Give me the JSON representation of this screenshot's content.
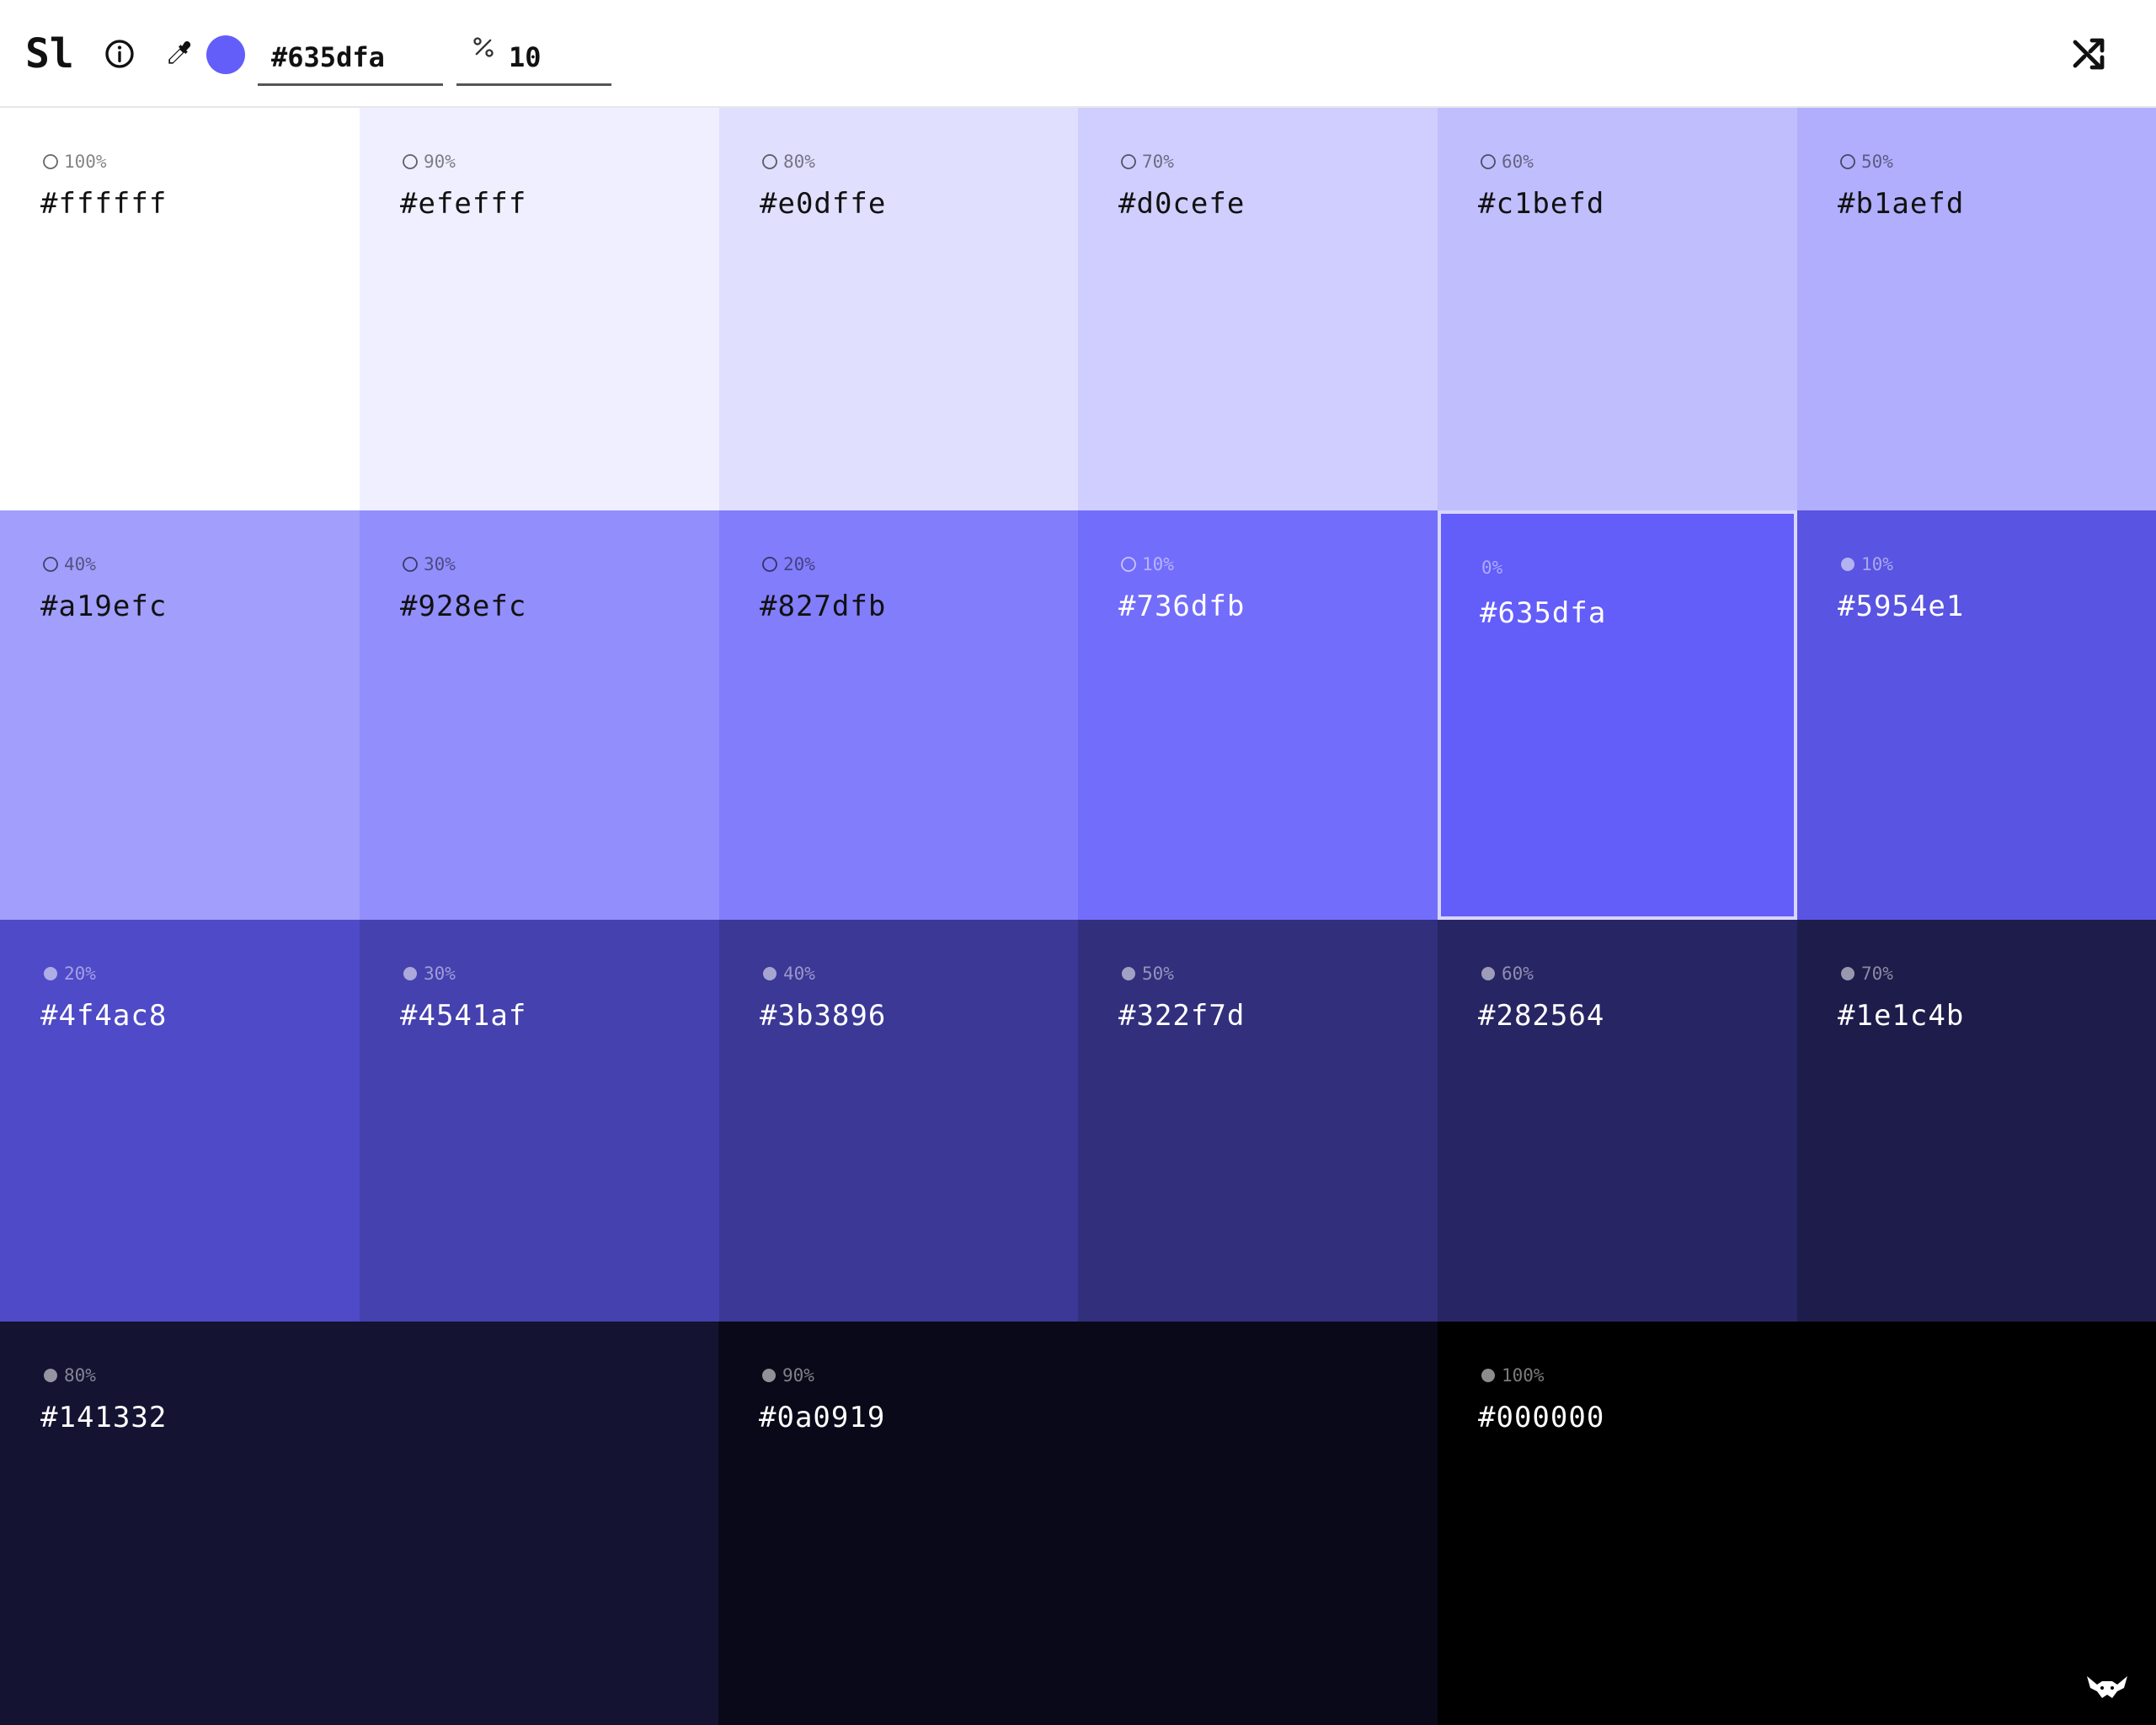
{
  "app": {
    "logo": "Sl"
  },
  "toolbar": {
    "base_color": "#635dfa",
    "hex_value": "#635dfa",
    "step_value": "10",
    "icons": {
      "info": "info-icon",
      "eyedropper": "eyedropper-icon",
      "percent": "percent-icon",
      "shuffle": "shuffle-icon"
    }
  },
  "palette": {
    "tints": [
      {
        "hex": "#ffffff",
        "pct": "100%"
      },
      {
        "hex": "#efefff",
        "pct": "90%"
      },
      {
        "hex": "#e0dffe",
        "pct": "80%"
      },
      {
        "hex": "#d0cefe",
        "pct": "70%"
      },
      {
        "hex": "#c1befd",
        "pct": "60%"
      },
      {
        "hex": "#b1aefd",
        "pct": "50%"
      },
      {
        "hex": "#a19efc",
        "pct": "40%"
      },
      {
        "hex": "#928efc",
        "pct": "30%"
      },
      {
        "hex": "#827dfb",
        "pct": "20%"
      },
      {
        "hex": "#736dfb",
        "pct": "10%"
      }
    ],
    "base": {
      "hex": "#635dfa",
      "pct": "0%"
    },
    "shades": [
      {
        "hex": "#5954e1",
        "pct": "10%"
      },
      {
        "hex": "#4f4ac8",
        "pct": "20%"
      },
      {
        "hex": "#4541af",
        "pct": "30%"
      },
      {
        "hex": "#3b3896",
        "pct": "40%"
      },
      {
        "hex": "#322f7d",
        "pct": "50%"
      },
      {
        "hex": "#282564",
        "pct": "60%"
      },
      {
        "hex": "#1e1c4b",
        "pct": "70%"
      },
      {
        "hex": "#141332",
        "pct": "80%"
      },
      {
        "hex": "#0a0919",
        "pct": "90%"
      },
      {
        "hex": "#000000",
        "pct": "100%"
      }
    ]
  },
  "footer": {
    "brand_icon": "fox-logo-icon"
  }
}
